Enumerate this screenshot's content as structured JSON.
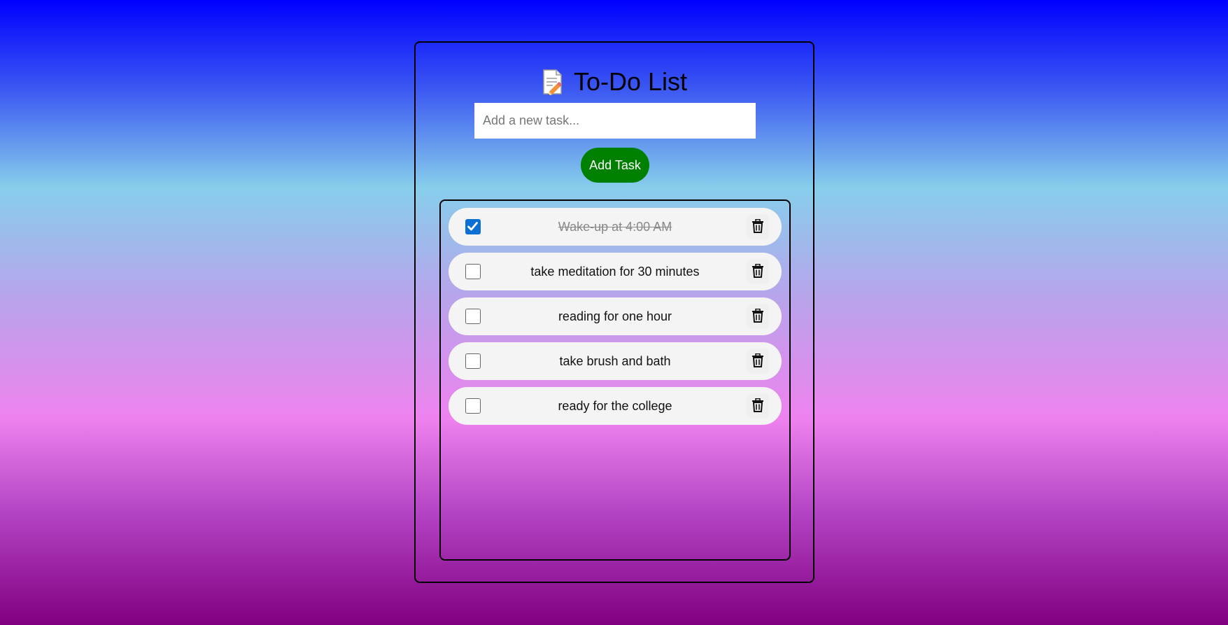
{
  "app": {
    "title": "To-Do List",
    "title_icon": "memo-pencil-icon"
  },
  "input": {
    "value": "",
    "placeholder": "Add a new task..."
  },
  "add_button": {
    "label": "Add Task",
    "color": "#008000"
  },
  "tasks": [
    {
      "text": "Wake-up at 4:00 AM",
      "completed": true
    },
    {
      "text": "take meditation for 30 minutes",
      "completed": false
    },
    {
      "text": "reading for one hour",
      "completed": false
    },
    {
      "text": "take brush and bath",
      "completed": false
    },
    {
      "text": "ready for the college",
      "completed": false
    }
  ],
  "icons": {
    "delete": "trash-icon",
    "check": "checkbox"
  },
  "colors": {
    "gradient": [
      "#0000ff",
      "#87ceeb",
      "#ee82ee",
      "#800080"
    ],
    "checked": "#0b6fd3",
    "task_bg": "#f4f4f4"
  }
}
